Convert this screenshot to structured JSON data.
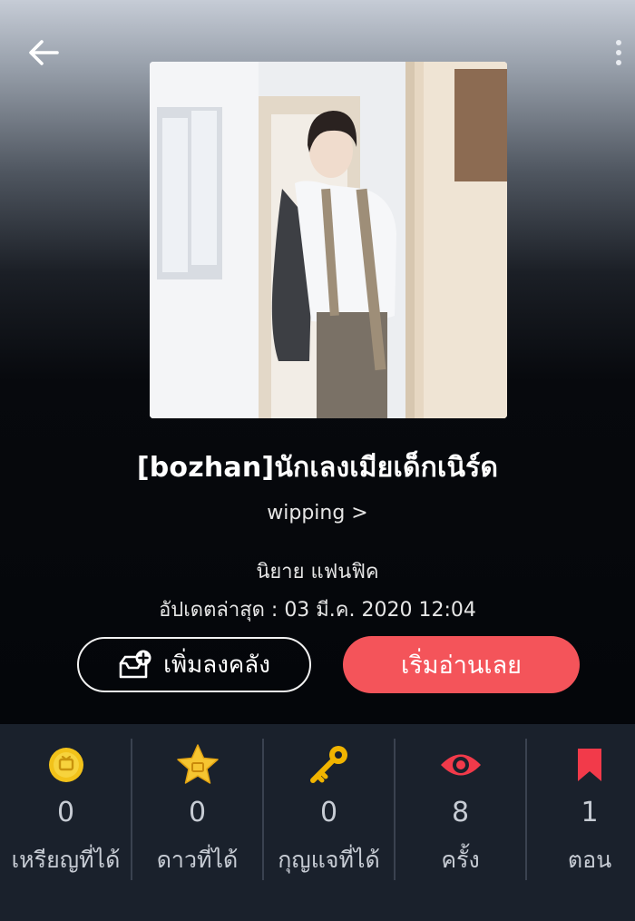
{
  "header": {
    "back_icon": "arrow-left-icon",
    "more_icon": "more-vertical-icon"
  },
  "story": {
    "title": "[bozhan]นักเลงเมียเด็กเนิร์ด",
    "author": "wipping >",
    "category": "นิยาย แฟนฟิค",
    "updated": "อัปเดตล่าสุด : 03 มี.ค. 2020 12:04"
  },
  "actions": {
    "add_library_label": "เพิ่มลงคลัง",
    "start_reading_label": "เริ่มอ่านเลย"
  },
  "stats": [
    {
      "value": "0",
      "label": "เหรียญที่ได้",
      "icon": "coin-icon"
    },
    {
      "value": "0",
      "label": "ดาวที่ได้",
      "icon": "star-icon"
    },
    {
      "value": "0",
      "label": "กุญแจที่ได้",
      "icon": "key-icon"
    },
    {
      "value": "8",
      "label": "ครั้ง",
      "icon": "eye-icon"
    },
    {
      "value": "1",
      "label": "ตอน",
      "icon": "bookmark-icon"
    }
  ],
  "colors": {
    "accent": "#f4545a",
    "stats_background": "#1a212c",
    "coin": "#f2c21a",
    "star": "#f6c531",
    "key": "#f0b400",
    "eye": "#f23a4a",
    "bookmark": "#f23a4a"
  }
}
